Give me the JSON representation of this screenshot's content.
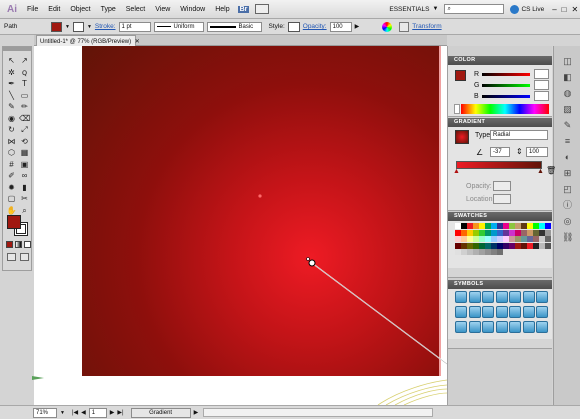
{
  "app": {
    "logo": "Ai"
  },
  "menu": [
    "File",
    "Edit",
    "Object",
    "Type",
    "Select",
    "View",
    "Window",
    "Help"
  ],
  "workspace": {
    "label": "ESSENTIALS",
    "search_placeholder": "",
    "cs_live": "CS Live"
  },
  "control": {
    "selection": "Path",
    "stroke_label": "Stroke:",
    "stroke_value": "1 pt",
    "profile": "Uniform",
    "brush": "Basic",
    "style_label": "Style:",
    "opacity_label": "Opacity:",
    "opacity_value": "100",
    "transform_label": "Transform"
  },
  "document": {
    "tab_title": "Untitled-1* @ 77% (RGB/Preview)"
  },
  "tools": {
    "icons": [
      "selection-icon",
      "direct-selection-icon",
      "magic-wand-icon",
      "lasso-icon",
      "pen-icon",
      "type-icon",
      "line-icon",
      "rectangle-icon",
      "paintbrush-icon",
      "pencil-icon",
      "blob-brush-icon",
      "eraser-icon",
      "rotate-icon",
      "scale-icon",
      "width-icon",
      "free-transform-icon",
      "shape-builder-icon",
      "perspective-icon",
      "mesh-icon",
      "gradient-icon",
      "eyedropper-icon",
      "blend-icon",
      "symbol-sprayer-icon",
      "column-graph-icon",
      "artboard-icon",
      "slice-icon",
      "hand-icon",
      "zoom-icon"
    ]
  },
  "color_panel": {
    "title": "COLOR",
    "channels": [
      "R",
      "G",
      "B"
    ]
  },
  "gradient_panel": {
    "title": "GRADIENT",
    "type_label": "Type:",
    "type_value": "Radial",
    "angle": "-37",
    "aspect": "100",
    "opacity_label": "Opacity:",
    "location_label": "Location:"
  },
  "swatches_panel": {
    "title": "SWATCHES"
  },
  "symbols_panel": {
    "title": "SYMBOLS"
  },
  "status": {
    "zoom": "71%",
    "artboard": "1",
    "tool": "Gradient"
  },
  "colors": {
    "accent": "#ee1b24",
    "dark": "#611408",
    "panel_header": "#555555"
  }
}
